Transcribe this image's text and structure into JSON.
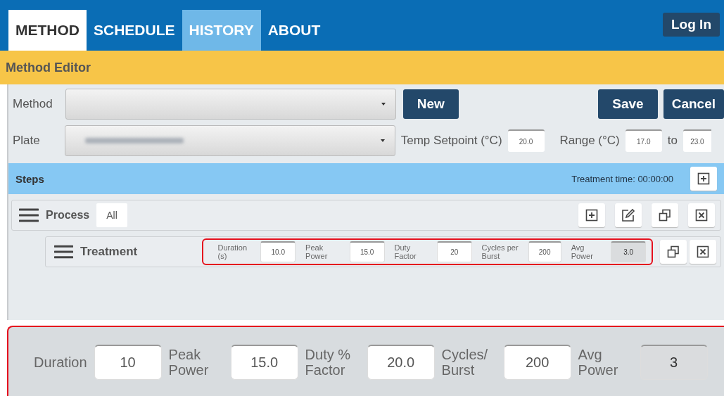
{
  "tabs": [
    {
      "label": "METHOD",
      "selected": true,
      "highlighted": false
    },
    {
      "label": "SCHEDULE",
      "selected": false,
      "highlighted": false
    },
    {
      "label": "HISTORY",
      "selected": false,
      "highlighted": true
    },
    {
      "label": "ABOUT",
      "selected": false,
      "highlighted": false
    }
  ],
  "login_button": "Log In",
  "editor": {
    "title": "Method Editor",
    "method": {
      "label": "Method",
      "new_button": "New",
      "save_button": "Save",
      "cancel_button": "Cancel"
    },
    "plate": {
      "label": "Plate",
      "value_blurred": true
    },
    "temp_setpoint": {
      "label": "Temp Setpoint (°C)",
      "value": "20.0"
    },
    "range": {
      "label": "Range (°C)",
      "from": "17.0",
      "to_label": "to",
      "to": "23.0"
    }
  },
  "steps": {
    "title": "Steps",
    "treatment_time": "Treatment time: 00:00:00"
  },
  "process": {
    "label": "Process",
    "filter": "All"
  },
  "treatment": {
    "label": "Treatment",
    "highlighted": true,
    "fields": [
      {
        "label": "Duration (s)",
        "value": "10.0",
        "disabled": false
      },
      {
        "label": "Peak Power",
        "value": "15.0",
        "disabled": false
      },
      {
        "label": "Duty Factor",
        "value": "20",
        "disabled": false
      },
      {
        "label": "Cycles per Burst",
        "value": "200",
        "disabled": false
      },
      {
        "label": "Avg Power",
        "value": "3.0",
        "disabled": true
      }
    ]
  },
  "inset": {
    "fields": [
      {
        "label": "Duration",
        "value": "10",
        "disabled": false
      },
      {
        "label": "Peak Power",
        "value": "15.0",
        "disabled": false
      },
      {
        "label": "Duty % Factor",
        "value": "20.0",
        "disabled": false
      },
      {
        "label": "Cycles/ Burst",
        "value": "200",
        "disabled": false
      },
      {
        "label": "Avg Power",
        "value": "3",
        "disabled": true
      }
    ]
  }
}
